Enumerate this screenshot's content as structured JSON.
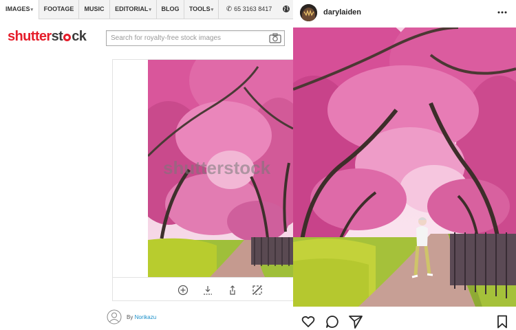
{
  "stock_site": {
    "nav": {
      "images": "IMAGES",
      "footage": "FOOTAGE",
      "music": "MUSIC",
      "editorial": "EDITORIAL",
      "blog": "BLOG",
      "tools": "TOOLS",
      "phone": "65 3163 8417"
    },
    "logo": {
      "part1": "shutter",
      "part2": "st",
      "part3": "ck"
    },
    "search": {
      "placeholder": "Search for royalty-free stock images"
    },
    "watermark": "shutterstock",
    "author": {
      "prefix": "By",
      "name": "Norikazu"
    },
    "colors": {
      "brand_red": "#e51d2a",
      "link_blue": "#1a8fc9"
    }
  },
  "post": {
    "username": "darylaiden",
    "icons": [
      "heart-icon",
      "comment-icon",
      "share-icon",
      "bookmark-icon"
    ]
  }
}
